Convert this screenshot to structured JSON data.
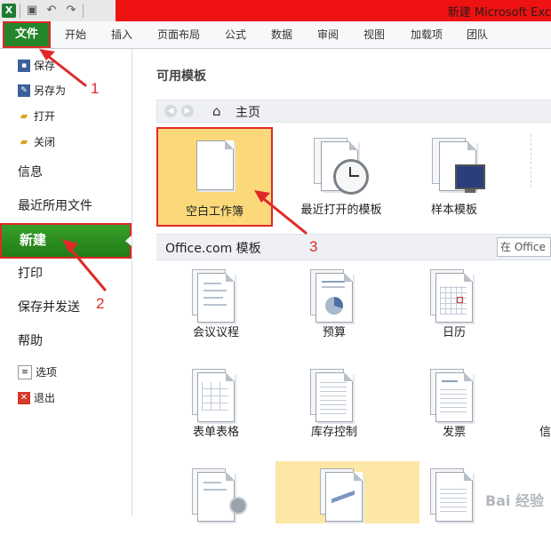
{
  "window": {
    "title": "新建 Microsoft Exc"
  },
  "quick_access": {
    "app_icon": "X",
    "save_icon": "save-icon",
    "undo_icon": "undo-icon",
    "redo_icon": "redo-icon"
  },
  "ribbon_tabs": [
    {
      "label": "文件",
      "active": true
    },
    {
      "label": "开始"
    },
    {
      "label": "插入"
    },
    {
      "label": "页面布局"
    },
    {
      "label": "公式"
    },
    {
      "label": "数据"
    },
    {
      "label": "审阅"
    },
    {
      "label": "视图"
    },
    {
      "label": "加载项"
    },
    {
      "label": "团队"
    }
  ],
  "backstage_nav": {
    "save": "保存",
    "save_as": "另存为",
    "open": "打开",
    "close": "关闭",
    "info": "信息",
    "recent": "最近所用文件",
    "new": "新建",
    "print": "打印",
    "save_send": "保存并发送",
    "help": "帮助",
    "options": "选项",
    "exit": "退出"
  },
  "content": {
    "section_title": "可用模板",
    "nav_home": "主页",
    "tiles_top": [
      {
        "label": "空白工作簿",
        "selected": true
      },
      {
        "label": "最近打开的模板"
      },
      {
        "label": "样本模板"
      }
    ],
    "office_section": "Office.com 模板",
    "search_placeholder": "在 Office",
    "tiles_row2": [
      {
        "label": "会议议程"
      },
      {
        "label": "预算"
      },
      {
        "label": "日历"
      }
    ],
    "tiles_row3": [
      {
        "label": "表单表格"
      },
      {
        "label": "库存控制"
      },
      {
        "label": "发票"
      },
      {
        "label": "信"
      }
    ]
  },
  "callouts": {
    "n1": "1",
    "n2": "2",
    "n3": "3"
  },
  "colors": {
    "accent_green": "#2d8a1e",
    "title_red": "#ee1212",
    "selection_yellow": "#fbd97a",
    "callout_red": "#e02828"
  },
  "watermark": "Bai 经验"
}
